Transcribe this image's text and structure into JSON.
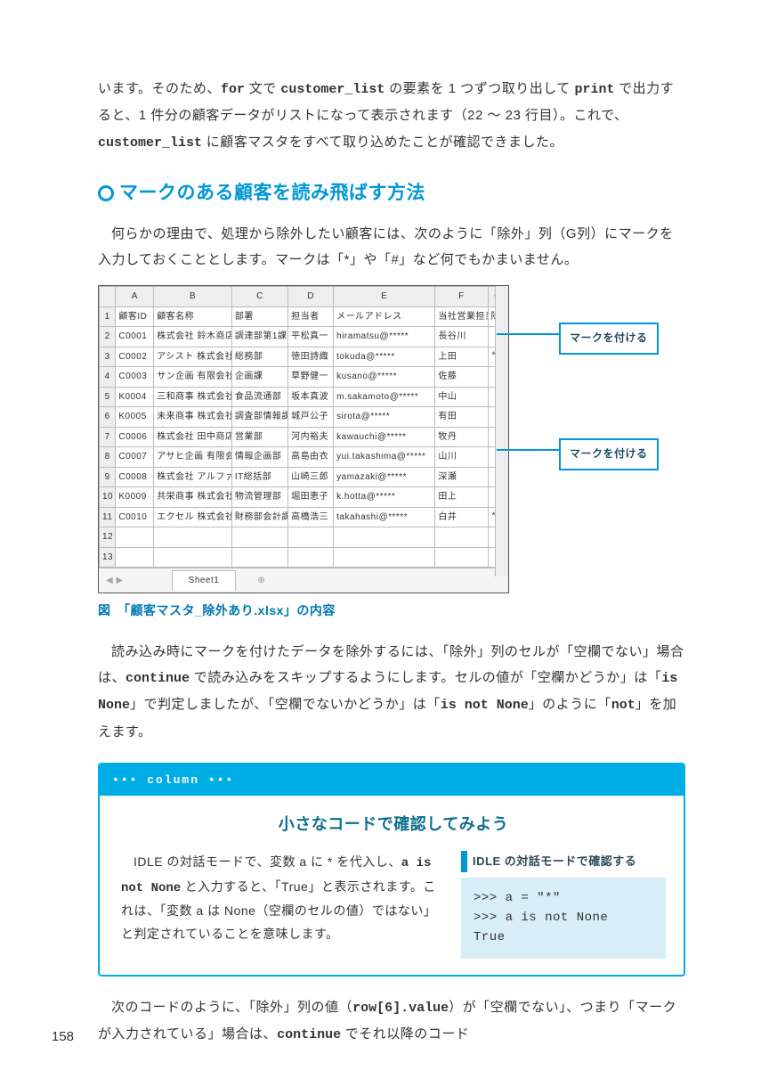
{
  "para1_a": "います。そのため、",
  "para1_for": "for",
  "para1_b": " 文で ",
  "para1_cl": "customer_list",
  "para1_c": " の要素を 1 つずつ取り出して ",
  "para1_print": "print",
  "para1_d": " で出力すると、1 件分の顧客データがリストになって表示されます（22 ～ 23 行目）。これで、",
  "para1_cl2": "customer_list",
  "para1_e": " に顧客マスタをすべて取り込めたことが確認できました。",
  "heading": "マークのある顧客を読み飛ばす方法",
  "para2": "何らかの理由で、処理から除外したい顧客には、次のように「除外」列（G列）にマークを入力しておくこととします。マークは「*」や「#」など何でもかまいません。",
  "excel": {
    "cols": [
      "",
      "A",
      "B",
      "C",
      "D",
      "E",
      "F",
      "G"
    ],
    "header": [
      "顧客ID",
      "顧客名称",
      "部署",
      "担当者",
      "メールアドレス",
      "当社営業担当",
      "除外"
    ],
    "rows": [
      [
        "C0001",
        "株式会社 鈴木商店",
        "調達部第1課",
        "平松真一",
        "hiramatsu@*****",
        "長谷川",
        ""
      ],
      [
        "C0002",
        "アシスト 株式会社",
        "総務部",
        "徳田詩織",
        "tokuda@*****",
        "上田",
        "*"
      ],
      [
        "C0003",
        "サン企画 有限会社",
        "企画課",
        "草野健一",
        "kusano@*****",
        "佐藤",
        ""
      ],
      [
        "K0004",
        "三和商事 株式会社",
        "食品流通部",
        "坂本真波",
        "m.sakamoto@*****",
        "中山",
        ""
      ],
      [
        "K0005",
        "未来商事 株式会社",
        "調査部情報課",
        "城戸公子",
        "sirota@*****",
        "有田",
        ""
      ],
      [
        "C0006",
        "株式会社 田中商店",
        "営業部",
        "河内裕夫",
        "kawauchi@*****",
        "牧丹",
        ""
      ],
      [
        "C0007",
        "アサヒ企画 有限会社",
        "情報企画部",
        "高島由衣",
        "yui.takashima@*****",
        "山川",
        ""
      ],
      [
        "C0008",
        "株式会社 アルファ",
        "IT総括部",
        "山崎三郎",
        "yamazaki@*****",
        "深瀬",
        ""
      ],
      [
        "K0009",
        "共栄商事 株式会社",
        "物流管理部",
        "堀田恵子",
        "k.hotta@*****",
        "田上",
        ""
      ],
      [
        "C0010",
        "エクセル 株式会社",
        "財務部会計課",
        "高橋浩三",
        "takahashi@*****",
        "白井",
        "*"
      ]
    ],
    "sheet": "Sheet1"
  },
  "callout_mark": "マークを付ける",
  "fig_caption": "図　「顧客マスタ_除外あり.xlsx」の内容",
  "para3_a": "読み込み時にマークを付けたデータを除外するには、「除外」列のセルが「空欄でない」場合は、",
  "para3_continue": "continue",
  "para3_b": " で読み込みをスキップするようにします。セルの値が「空欄かどうか」は「",
  "para3_isnone": "is None",
  "para3_c": "」で判定しましたが、「空欄でないかどうか」は「",
  "para3_isnotnone": "is not None",
  "para3_d": "」のように「",
  "para3_not": "not",
  "para3_e": "」を加えます。",
  "column": {
    "header": "••• column •••",
    "title": "小さなコードで確認してみよう",
    "text_a": "IDLE の対話モードで、変数 a に * を代入し、",
    "code1": "a is not None",
    "text_b": " と入力すると、「True」と表示されます。これは、「変数 a は None（空欄のセルの値）ではない」と判定されていることを意味します。",
    "idle_caption": "IDLE の対話モードで確認する",
    "idle_code": ">>> a = \"*\"\n>>> a is not None\nTrue"
  },
  "para4_a": "次のコードのように、「除外」列の値（",
  "para4_row": "row[6].value",
  "para4_b": "）が「空欄でない」、つまり「マークが入力されている」場合は、",
  "para4_continue": "continue",
  "para4_c": " でそれ以降のコード",
  "page_number": "158"
}
